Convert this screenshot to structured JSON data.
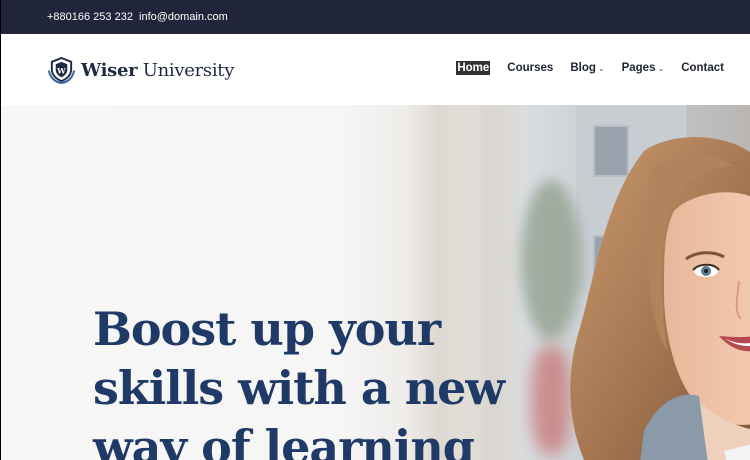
{
  "topbar": {
    "phone": "+880166 253 232",
    "email": "info@domain.com"
  },
  "brand": {
    "name_bold": "Wiser",
    "name_rest": "University"
  },
  "nav": {
    "items": [
      {
        "label": "Home",
        "active": true
      },
      {
        "label": "Courses"
      },
      {
        "label": "Blog",
        "dropdown": true
      },
      {
        "label": "Pages",
        "dropdown": true
      },
      {
        "label": "Contact"
      }
    ]
  },
  "hero": {
    "headline": "Boost up your skills with a new way of learning"
  },
  "colors": {
    "topbar": "#21253a",
    "brand": "#1f3a66",
    "accent": "#3b6ea8"
  }
}
